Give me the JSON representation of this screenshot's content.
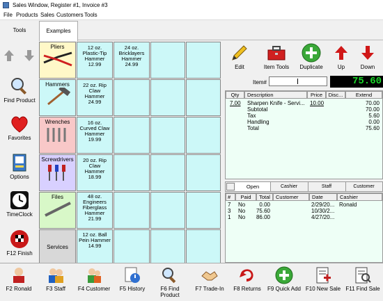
{
  "window": {
    "title": "Sales Window,  Register #1,  Invoice #3"
  },
  "menu": [
    "File",
    "Products",
    "Sales",
    "Customers",
    "Tools"
  ],
  "tabs": {
    "tools": "Tools",
    "examples": "Examples"
  },
  "left_buttons": {
    "find_product": "Find Product",
    "favorites": "Favorites",
    "options": "Options",
    "timeclock": "TimeClock",
    "finish": "F12 Finish"
  },
  "categories": [
    "Pliers",
    "Hammers",
    "Wrenches",
    "Screwdrivers",
    "Files",
    "Services"
  ],
  "products": [
    "24 oz. Bricklayers Hammer 24.99",
    "12 oz. Plastic-Tip Hammer 12.99",
    "22 oz. Rip Claw Hammer 24.99",
    "16 oz. Curved Claw Hammer 19.99",
    "20 oz. Rip Claw Hammer 18.99",
    "48 oz. Engineers Fiberglass Hammer 21.99",
    "12 oz. Ball Pein Hammer 14.99"
  ],
  "toolbar": {
    "edit": "Edit",
    "item_tools": "Item Tools",
    "duplicate": "Duplicate",
    "up": "Up",
    "down": "Down"
  },
  "item_label": "Item#",
  "total_display": "75.60",
  "invoice": {
    "headers": [
      "Qty",
      "Description",
      "Price",
      "Disc...",
      "Extend"
    ],
    "lines": [
      {
        "qty": "7.00",
        "desc": "Sharpen Knife - Servi...",
        "price": "10.00",
        "disc": "",
        "extend": "70.00"
      }
    ],
    "summary": [
      {
        "label": "Subtotal",
        "value": "70.00"
      },
      {
        "label": "Tax",
        "value": "5.60"
      },
      {
        "label": "Handling",
        "value": "0.00"
      },
      {
        "label": "Total",
        "value": "75.60"
      }
    ]
  },
  "lower_tabs": [
    "Open",
    "Cashier",
    "Staff",
    "Customer"
  ],
  "open_table": {
    "headers": [
      "#",
      "Paid",
      "Total",
      "Customer",
      "Date",
      "Cashier"
    ],
    "rows": [
      {
        "num": "7",
        "paid": "No",
        "total": "0.00",
        "customer": "",
        "date": "2/29/20...",
        "cashier": "Ronald"
      },
      {
        "num": "3",
        "paid": "No",
        "total": "75.60",
        "customer": "",
        "date": "10/30/2...",
        "cashier": ""
      },
      {
        "num": "1",
        "paid": "No",
        "total": "86.00",
        "customer": "",
        "date": "4/27/20...",
        "cashier": ""
      }
    ]
  },
  "bottom_buttons": [
    "F2 Ronald",
    "F3 Staff",
    "F4 Customer",
    "F5 History",
    "F6 Find Product",
    "F7 Trade-In",
    "F8 Returns",
    "F9 Quick Add",
    "F10 New Sale",
    "F11 Find Sale"
  ]
}
